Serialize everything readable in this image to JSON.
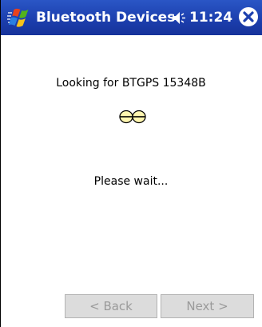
{
  "titlebar": {
    "title": "Bluetooth Devices",
    "time": "11:24",
    "icons": [
      "windows-flag-icon",
      "volume-icon",
      "close-icon"
    ]
  },
  "content": {
    "status_text": "Looking for BTGPS 15348B",
    "wait_text": "Please wait...",
    "busy_icon": "looking-eyes-icon"
  },
  "buttons": {
    "back_label": "< Back",
    "next_label": "Next >",
    "back_enabled": false,
    "next_enabled": false
  },
  "colors": {
    "titlebar": "#1c3fae",
    "background": "#ffffff",
    "button_face": "#dcdcdc",
    "button_text_disabled": "#9a9a9a"
  }
}
